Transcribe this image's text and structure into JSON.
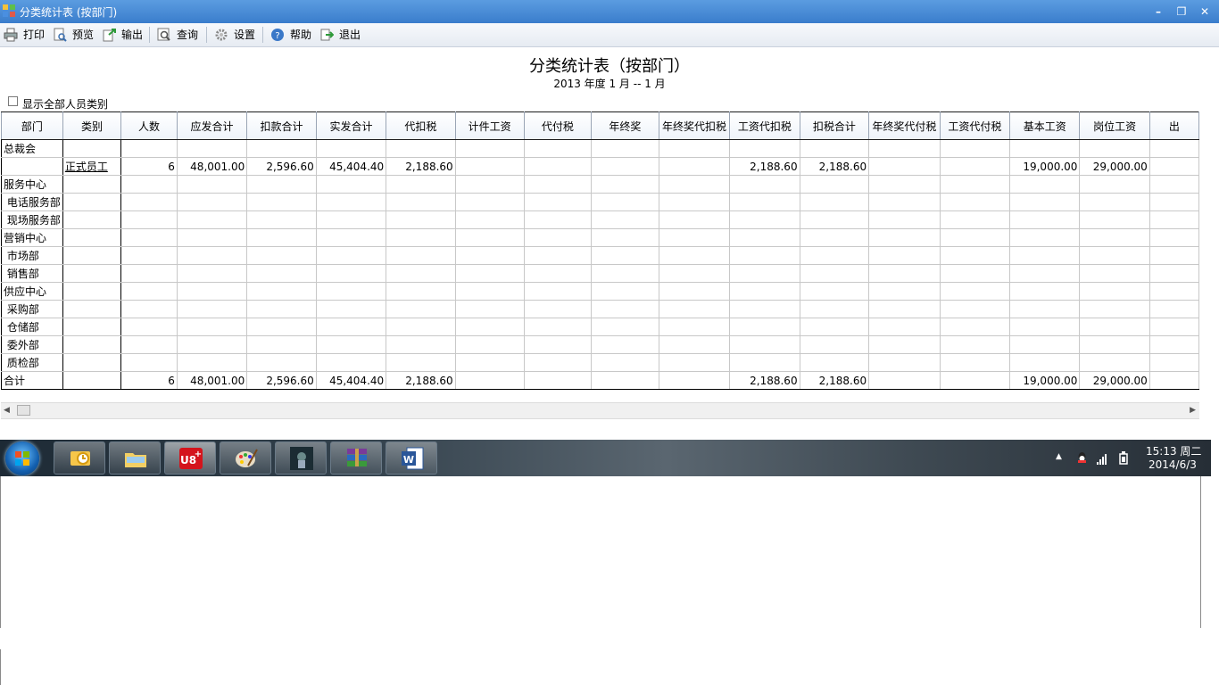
{
  "window": {
    "title": "分类统计表 (按部门)"
  },
  "toolbar": {
    "print": "打印",
    "preview": "预览",
    "export": "输出",
    "query": "查询",
    "settings": "设置",
    "help": "帮助",
    "exit": "退出"
  },
  "report": {
    "title": "分类统计表（按部门）",
    "period": "2013 年度 1 月 -- 1 月",
    "show_all_label": "显示全部人员类别"
  },
  "table": {
    "headers": [
      "部门",
      "类别",
      "人数",
      "应发合计",
      "扣款合计",
      "实发合计",
      "代扣税",
      "计件工资",
      "代付税",
      "年终奖",
      "年终奖代扣税",
      "工资代扣税",
      "扣税合计",
      "年终奖代付税",
      "工资代付税",
      "基本工资",
      "岗位工资",
      "出"
    ],
    "rows": [
      [
        "总裁会",
        "",
        "",
        "",
        "",
        "",
        "",
        "",
        "",
        "",
        "",
        "",
        "",
        "",
        "",
        "",
        "",
        ""
      ],
      [
        "",
        "正式员工",
        "6",
        "48,001.00",
        "2,596.60",
        "45,404.40",
        "2,188.60",
        "",
        "",
        "",
        "",
        "2,188.60",
        "2,188.60",
        "",
        "",
        "19,000.00",
        "29,000.00",
        ""
      ],
      [
        "服务中心",
        "",
        "",
        "",
        "",
        "",
        "",
        "",
        "",
        "",
        "",
        "",
        "",
        "",
        "",
        "",
        "",
        ""
      ],
      [
        " 电话服务部",
        "",
        "",
        "",
        "",
        "",
        "",
        "",
        "",
        "",
        "",
        "",
        "",
        "",
        "",
        "",
        "",
        ""
      ],
      [
        " 现场服务部",
        "",
        "",
        "",
        "",
        "",
        "",
        "",
        "",
        "",
        "",
        "",
        "",
        "",
        "",
        "",
        "",
        ""
      ],
      [
        "营销中心",
        "",
        "",
        "",
        "",
        "",
        "",
        "",
        "",
        "",
        "",
        "",
        "",
        "",
        "",
        "",
        "",
        ""
      ],
      [
        " 市场部",
        "",
        "",
        "",
        "",
        "",
        "",
        "",
        "",
        "",
        "",
        "",
        "",
        "",
        "",
        "",
        "",
        ""
      ],
      [
        " 销售部",
        "",
        "",
        "",
        "",
        "",
        "",
        "",
        "",
        "",
        "",
        "",
        "",
        "",
        "",
        "",
        "",
        ""
      ],
      [
        "供应中心",
        "",
        "",
        "",
        "",
        "",
        "",
        "",
        "",
        "",
        "",
        "",
        "",
        "",
        "",
        "",
        "",
        ""
      ],
      [
        " 采购部",
        "",
        "",
        "",
        "",
        "",
        "",
        "",
        "",
        "",
        "",
        "",
        "",
        "",
        "",
        "",
        "",
        ""
      ],
      [
        " 仓储部",
        "",
        "",
        "",
        "",
        "",
        "",
        "",
        "",
        "",
        "",
        "",
        "",
        "",
        "",
        "",
        "",
        ""
      ],
      [
        " 委外部",
        "",
        "",
        "",
        "",
        "",
        "",
        "",
        "",
        "",
        "",
        "",
        "",
        "",
        "",
        "",
        "",
        ""
      ],
      [
        " 质检部",
        "",
        "",
        "",
        "",
        "",
        "",
        "",
        "",
        "",
        "",
        "",
        "",
        "",
        "",
        "",
        "",
        ""
      ]
    ],
    "total": [
      "合计",
      "",
      "6",
      "48,001.00",
      "2,596.60",
      "45,404.40",
      "2,188.60",
      "",
      "",
      "",
      "",
      "2,188.60",
      "2,188.60",
      "",
      "",
      "19,000.00",
      "29,000.00",
      ""
    ]
  },
  "taskbar": {
    "apps": [
      "outlook-icon",
      "explorer-icon",
      "u8-icon",
      "paint-icon",
      "media-icon",
      "winrar-icon",
      "word-icon"
    ],
    "u8_label": "U8",
    "time": "15:13 周二",
    "date": "2014/6/3"
  }
}
